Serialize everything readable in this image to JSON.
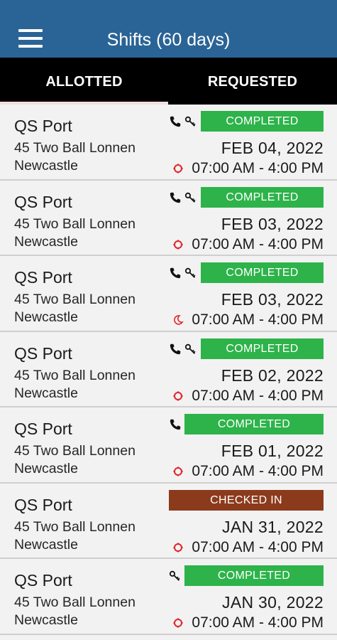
{
  "header": {
    "title": "Shifts (60 days)",
    "menu_icon": "hamburger-menu-icon"
  },
  "tabs": [
    {
      "label": "ALLOTTED",
      "active": true
    },
    {
      "label": "REQUESTED",
      "active": false
    }
  ],
  "colors": {
    "appbar": "#2a6496",
    "completed": "#2db34a",
    "checked_in": "#8b3b1c",
    "status_icon": "#e0262a"
  },
  "shifts": [
    {
      "site": "QS Port",
      "address1": "45 Two Ball Lonnen",
      "address2": "Newcastle",
      "status": "COMPLETED",
      "date": "FEB 04, 2022",
      "time": "07:00 AM - 4:00 PM",
      "icons": [
        "phone-icon",
        "key-icon"
      ],
      "time_icon": "circle-icon"
    },
    {
      "site": "QS Port",
      "address1": "45 Two Ball Lonnen",
      "address2": "Newcastle",
      "status": "COMPLETED",
      "date": "FEB 03, 2022",
      "time": "07:00 AM - 4:00 PM",
      "icons": [
        "phone-icon",
        "key-icon"
      ],
      "time_icon": "circle-icon"
    },
    {
      "site": "QS Port",
      "address1": "45 Two Ball Lonnen",
      "address2": "Newcastle",
      "status": "COMPLETED",
      "date": "FEB 03, 2022",
      "time": "07:00 AM - 4:00 PM",
      "icons": [
        "phone-icon",
        "key-icon"
      ],
      "time_icon": "moon-icon"
    },
    {
      "site": "QS Port",
      "address1": "45 Two Ball Lonnen",
      "address2": "Newcastle",
      "status": "COMPLETED",
      "date": "FEB 02, 2022",
      "time": "07:00 AM - 4:00 PM",
      "icons": [
        "phone-icon",
        "key-icon"
      ],
      "time_icon": "circle-icon"
    },
    {
      "site": "QS Port",
      "address1": "45 Two Ball Lonnen",
      "address2": "Newcastle",
      "status": "COMPLETED",
      "date": "FEB 01, 2022",
      "time": "07:00 AM - 4:00 PM",
      "icons": [
        "phone-icon"
      ],
      "time_icon": "circle-icon"
    },
    {
      "site": "QS Port",
      "address1": "45 Two Ball Lonnen",
      "address2": "Newcastle",
      "status": "CHECKED IN",
      "date": "JAN 31, 2022",
      "time": "07:00 AM - 4:00 PM",
      "icons": [],
      "time_icon": "circle-icon"
    },
    {
      "site": "QS Port",
      "address1": "45 Two Ball Lonnen",
      "address2": "Newcastle",
      "status": "COMPLETED",
      "date": "JAN 30, 2022",
      "time": "07:00 AM - 4:00 PM",
      "icons": [
        "key-icon"
      ],
      "time_icon": "circle-icon"
    }
  ]
}
